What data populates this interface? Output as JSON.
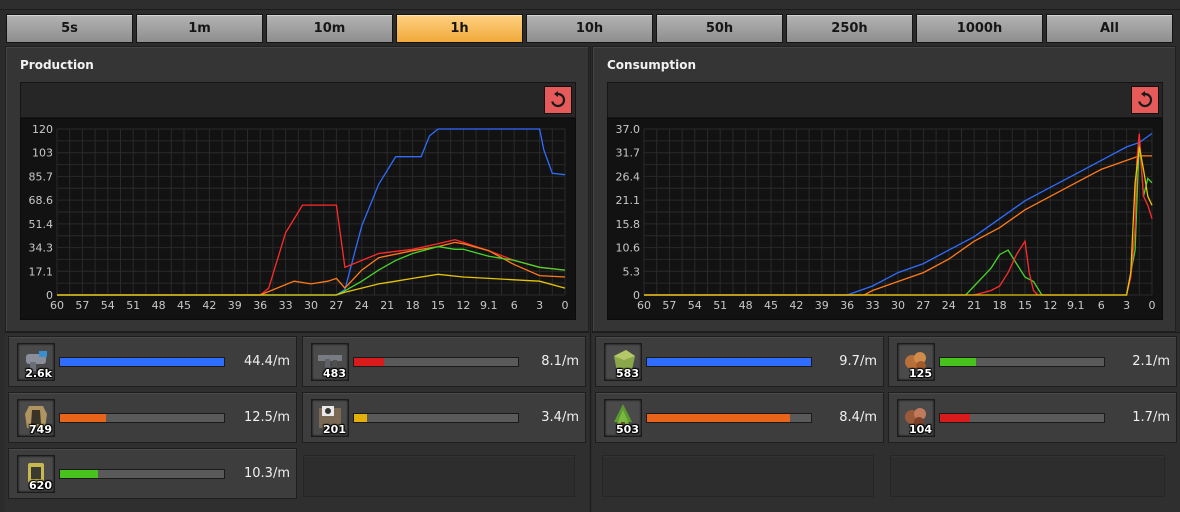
{
  "time_tabs": [
    "5s",
    "1m",
    "10m",
    "1h",
    "10h",
    "50h",
    "250h",
    "1000h",
    "All"
  ],
  "active_tab": "1h",
  "colors": {
    "blue": "#2f6dff",
    "orange": "#ff7a1a",
    "green": "#48d52b",
    "red": "#ff2b2b",
    "yellow": "#e5c40a"
  },
  "production": {
    "title": "Production",
    "chart_data": {
      "type": "line",
      "x_ticks": [
        "60",
        "57",
        "54",
        "51",
        "48",
        "45",
        "42",
        "39",
        "36",
        "33",
        "30",
        "27",
        "24",
        "21",
        "18",
        "15",
        "12",
        "9.1",
        "6",
        "3",
        "0"
      ],
      "y_ticks": [
        "120",
        "103",
        "85.7",
        "68.6",
        "51.4",
        "34.3",
        "17.1",
        "0"
      ],
      "xlim": [
        60,
        0
      ],
      "ylim": [
        0,
        120
      ],
      "series": [
        {
          "color": "#2f6dff",
          "x": [
            60,
            35,
            30,
            27,
            26,
            24,
            22,
            20,
            18,
            17,
            16,
            15,
            14,
            12,
            8,
            3,
            2.5,
            1.5,
            0
          ],
          "y": [
            0,
            0,
            0,
            0,
            4,
            50,
            80,
            100,
            100,
            100,
            115,
            120,
            120,
            120,
            120,
            120,
            105,
            88,
            87
          ]
        },
        {
          "color": "#ff2b2b",
          "x": [
            60,
            36,
            35,
            33,
            31,
            30,
            29,
            27,
            26,
            24,
            22,
            18,
            15,
            13,
            12,
            9,
            6,
            3,
            0
          ],
          "y": [
            0,
            0,
            5,
            45,
            65,
            65,
            65,
            65,
            20,
            25,
            30,
            33,
            37,
            40,
            38,
            32,
            25,
            20,
            18
          ]
        },
        {
          "color": "#ff7a1a",
          "x": [
            60,
            36,
            34,
            32,
            30,
            28,
            27,
            26,
            24,
            22,
            18,
            15,
            13,
            12,
            9,
            6,
            3,
            0
          ],
          "y": [
            0,
            0,
            5,
            10,
            8,
            10,
            12,
            5,
            18,
            27,
            32,
            35,
            38,
            37,
            32,
            22,
            14,
            13
          ]
        },
        {
          "color": "#48d52b",
          "x": [
            60,
            27,
            26,
            24,
            22,
            20,
            18,
            15,
            13,
            12,
            9,
            6,
            3,
            0
          ],
          "y": [
            0,
            0,
            3,
            10,
            18,
            25,
            30,
            35,
            33,
            33,
            28,
            25,
            20,
            18
          ]
        },
        {
          "color": "#e5c40a",
          "x": [
            60,
            27,
            26,
            24,
            22,
            20,
            18,
            15,
            12,
            9,
            6,
            3,
            0
          ],
          "y": [
            0,
            0,
            2,
            5,
            8,
            10,
            12,
            15,
            13,
            12,
            11,
            10,
            5
          ]
        }
      ]
    },
    "items": [
      {
        "name": "pistol-icon",
        "count": "2.6k",
        "rate": "44.4/m",
        "color": "#2f6dff",
        "fill": 1.0
      },
      {
        "name": "submachine-gun-icon",
        "count": "483",
        "rate": "8.1/m",
        "color": "#d81c1c",
        "fill": 0.18
      },
      {
        "name": "armor-icon",
        "count": "749",
        "rate": "12.5/m",
        "color": "#e8641a",
        "fill": 0.28
      },
      {
        "name": "ammo-crate-icon",
        "count": "201",
        "rate": "3.4/m",
        "color": "#e5b00a",
        "fill": 0.08
      },
      {
        "name": "magazine-icon",
        "count": "620",
        "rate": "10.3/m",
        "color": "#48c21c",
        "fill": 0.23
      }
    ]
  },
  "consumption": {
    "title": "Consumption",
    "chart_data": {
      "type": "line",
      "x_ticks": [
        "60",
        "57",
        "54",
        "51",
        "48",
        "45",
        "42",
        "39",
        "36",
        "33",
        "30",
        "27",
        "24",
        "21",
        "18",
        "15",
        "12",
        "9.1",
        "6",
        "3",
        "0"
      ],
      "y_ticks": [
        "37.0",
        "31.7",
        "26.4",
        "21.1",
        "15.8",
        "10.6",
        "5.3",
        "0"
      ],
      "xlim": [
        60,
        0
      ],
      "ylim": [
        0,
        37
      ],
      "series": [
        {
          "color": "#2f6dff",
          "x": [
            60,
            36,
            33,
            30,
            27,
            24,
            21,
            18,
            15,
            12,
            9,
            6,
            3,
            1.5,
            0
          ],
          "y": [
            0,
            0,
            2,
            5,
            7,
            10,
            13,
            17,
            21,
            24,
            27,
            30,
            33,
            34,
            36
          ]
        },
        {
          "color": "#ff7a1a",
          "x": [
            60,
            34,
            33,
            30,
            27,
            24,
            21,
            18,
            15,
            12,
            9,
            6,
            3,
            1.5,
            0
          ],
          "y": [
            0,
            0,
            1,
            3,
            5,
            8,
            12,
            15,
            19,
            22,
            25,
            28,
            30,
            31,
            31
          ]
        },
        {
          "color": "#48d52b",
          "x": [
            60,
            22,
            21,
            20,
            19,
            18,
            17,
            16,
            15,
            14,
            13,
            12,
            3,
            2,
            1.5,
            1,
            0.5,
            0
          ],
          "y": [
            0,
            0,
            2,
            4,
            6,
            9,
            10,
            7,
            4,
            3,
            0,
            0,
            0,
            10,
            35,
            22,
            26,
            25
          ]
        },
        {
          "color": "#ff2b2b",
          "x": [
            60,
            21,
            19,
            18,
            17,
            16,
            15,
            14.5,
            14,
            13.5,
            13,
            3,
            2.5,
            2,
            1.8,
            1.5,
            1,
            0.5,
            0
          ],
          "y": [
            0,
            0,
            1,
            2,
            5,
            9,
            12,
            5,
            1,
            0,
            0,
            0,
            4,
            15,
            30,
            36,
            22,
            20,
            17
          ]
        },
        {
          "color": "#e5c40a",
          "x": [
            60,
            3,
            2.5,
            2,
            1.5,
            1,
            0.5,
            0
          ],
          "y": [
            0,
            0,
            5,
            25,
            33,
            28,
            22,
            20
          ]
        }
      ]
    },
    "items": [
      {
        "name": "grass-block-icon",
        "count": "583",
        "rate": "9.7/m",
        "color": "#2f6dff",
        "fill": 1.0
      },
      {
        "name": "copper-ore-icon",
        "count": "125",
        "rate": "2.1/m",
        "color": "#48c21c",
        "fill": 0.22
      },
      {
        "name": "tree-sapling-icon",
        "count": "503",
        "rate": "8.4/m",
        "color": "#e8641a",
        "fill": 0.87
      },
      {
        "name": "iron-ore-icon",
        "count": "104",
        "rate": "1.7/m",
        "color": "#d81c1c",
        "fill": 0.18
      }
    ]
  }
}
